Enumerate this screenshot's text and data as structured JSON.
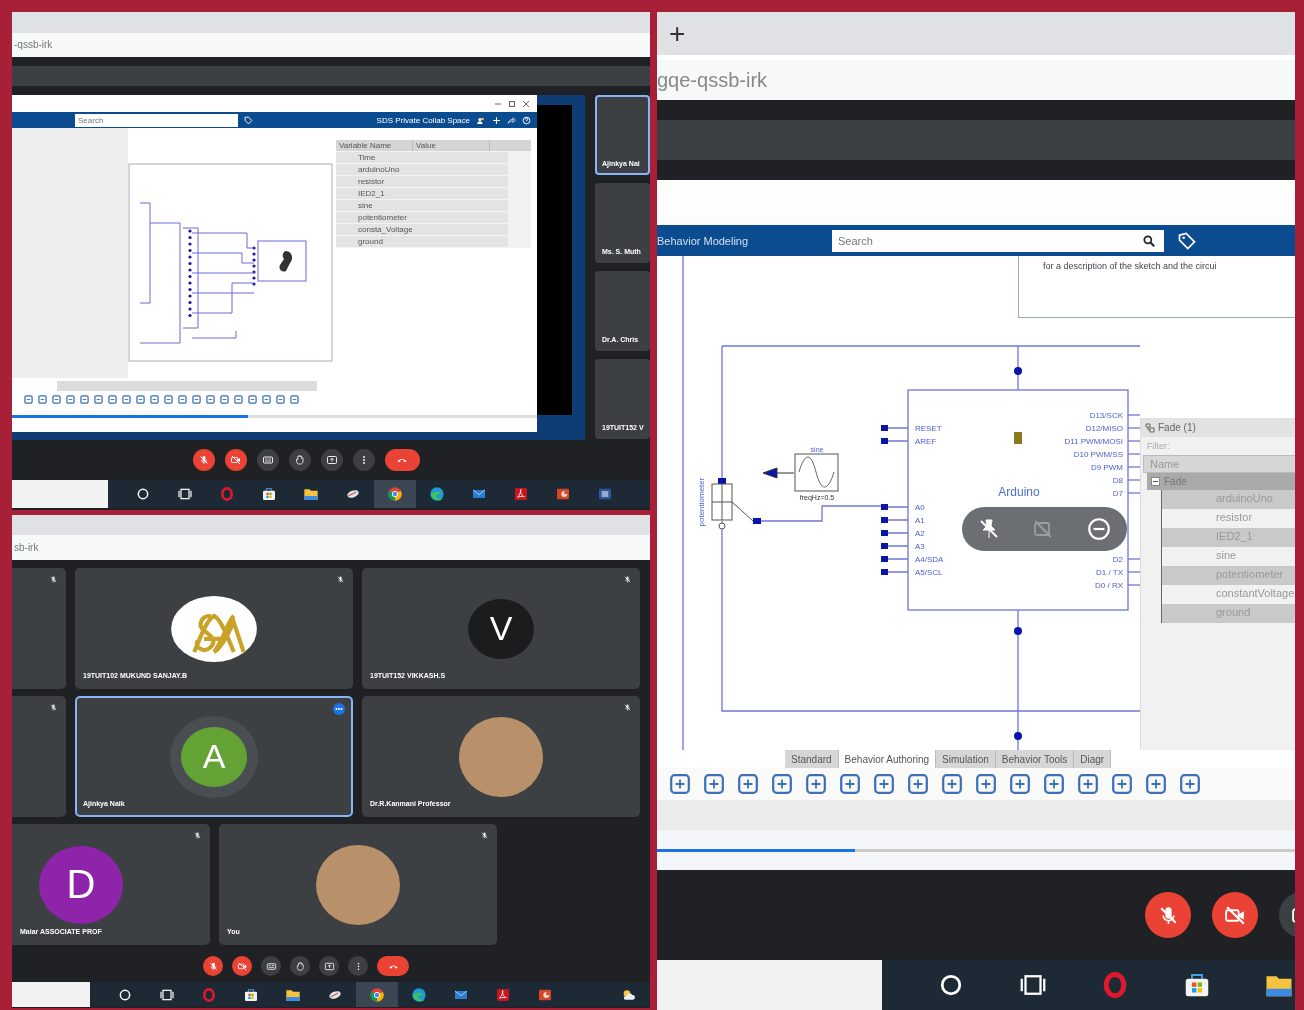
{
  "shared_screen": {
    "url": "-qssb-irk",
    "app": {
      "workspace": "SDS Private Collab Space",
      "search": {
        "placeholder": "Search"
      },
      "columns": [
        "Variable Name",
        "Value"
      ],
      "variables": [
        {
          "name": "Time"
        },
        {
          "name": "arduinoUno"
        },
        {
          "name": "resistor"
        },
        {
          "name": "IED2_1"
        },
        {
          "name": "sine"
        },
        {
          "name": "potentiometer"
        },
        {
          "name": "consta_Voltage"
        },
        {
          "name": "ground"
        }
      ]
    },
    "progress": {
      "level": 0.45
    },
    "participants": [
      {
        "name": "Ajinkya Nai",
        "selected": true
      },
      {
        "name": "Ms. S. Muth",
        "selected": false
      },
      {
        "name": "Dr.A. Chris",
        "selected": false
      },
      {
        "name": "19TUIT152 V",
        "selected": false
      }
    ],
    "controls": [
      {
        "kind": "mic-off"
      },
      {
        "kind": "camera-off"
      },
      {
        "kind": "captions"
      },
      {
        "kind": "hand"
      },
      {
        "kind": "present"
      },
      {
        "kind": "more"
      },
      {
        "kind": "end-call"
      }
    ],
    "taskbar": [
      {
        "kind": "search",
        "selected": false
      },
      {
        "kind": "task-view",
        "selected": false
      },
      {
        "kind": "opera",
        "selected": false
      },
      {
        "kind": "store",
        "selected": false
      },
      {
        "kind": "files",
        "selected": false
      },
      {
        "kind": "app",
        "selected": false
      },
      {
        "kind": "chrome",
        "selected": true
      },
      {
        "kind": "edge",
        "selected": false
      },
      {
        "kind": "mail",
        "selected": false
      },
      {
        "kind": "pdf",
        "selected": false
      },
      {
        "kind": "slides",
        "selected": false
      },
      {
        "kind": "word",
        "selected": false
      }
    ]
  },
  "grid_view": {
    "url": "sb-irk",
    "rows": [
      {
        "tiles": [
          {
            "kind": "partial",
            "muted": true,
            "selected": false
          },
          {
            "kind": "logo",
            "name": "19TUIT102 MUKUND SANJAY.B",
            "muted": true,
            "selected": false
          },
          {
            "kind": "letter",
            "initial": "V",
            "color": "#1b1c1e",
            "name": "19TUIT152 VIKKASH.S",
            "muted": true,
            "selected": false
          }
        ]
      },
      {
        "tiles": [
          {
            "kind": "partial",
            "muted": true,
            "selected": false
          },
          {
            "kind": "letter",
            "initial": "A",
            "color": "#63a234",
            "name": "Ajinkya Naik",
            "muted": false,
            "selected": true
          },
          {
            "kind": "photo",
            "name": "Dr.R.Kanmani Professor",
            "muted": true,
            "selected": false
          }
        ]
      },
      {
        "tiles": [
          {
            "kind": "letter",
            "initial": "D",
            "color": "#8e24aa",
            "name": "Maiar ASSOCIATE PROF",
            "muted": true,
            "selected": false
          },
          {
            "kind": "photo",
            "name": "You",
            "muted": true,
            "selected": false
          }
        ]
      }
    ],
    "controls": [
      {
        "kind": "mic-off"
      },
      {
        "kind": "camera-off"
      },
      {
        "kind": "captions"
      },
      {
        "kind": "hand"
      },
      {
        "kind": "present"
      },
      {
        "kind": "more"
      },
      {
        "kind": "end-call"
      }
    ],
    "taskbar": [
      {
        "kind": "search",
        "selected": false
      },
      {
        "kind": "task-view",
        "selected": false
      },
      {
        "kind": "opera",
        "selected": false
      },
      {
        "kind": "store",
        "selected": false
      },
      {
        "kind": "files",
        "selected": false
      },
      {
        "kind": "app",
        "selected": false
      },
      {
        "kind": "chrome",
        "selected": true
      },
      {
        "kind": "edge",
        "selected": false
      },
      {
        "kind": "mail",
        "selected": false
      },
      {
        "kind": "pdf",
        "selected": false
      },
      {
        "kind": "slides",
        "selected": false
      },
      {
        "kind": "weather",
        "selected": false
      }
    ]
  },
  "zoomed_view": {
    "new_tab": "+",
    "url": "gqe-qssb-irk",
    "app_title": "Behavior Modeling",
    "search": {
      "placeholder": "Search"
    },
    "note": "for a description of the sketch and the circui",
    "diagram": {
      "board": "Arduino",
      "left_pins": [
        "RESET",
        "AREF",
        "A0",
        "A1",
        "A2",
        "A3",
        "A4/SDA",
        "A5/SCL"
      ],
      "right_pins": [
        "D13/SCK",
        "D12/MISO",
        "D11 PWM/MOSI",
        "D10 PWM/SS",
        "D9 PWM",
        "D8",
        "D7",
        "D2",
        "D1 / TX",
        "D0 / RX"
      ],
      "source": "sine",
      "source_param": "freqHz=0.5",
      "component": "potentiometer"
    },
    "model_browser": {
      "tab": "Fade (1)",
      "filter": "Filter:",
      "column": "Name",
      "root": {
        "name": "Fade",
        "expanded": true,
        "children": [
          {
            "name": "arduinoUno"
          },
          {
            "name": "resistor"
          },
          {
            "name": "IED2_1"
          },
          {
            "name": "sine"
          },
          {
            "name": "potentiometer"
          },
          {
            "name": "constantVoltage"
          },
          {
            "name": "ground"
          }
        ]
      }
    },
    "tabs": [
      {
        "label": "Standard",
        "selected": false
      },
      {
        "label": "Behavior Authoring",
        "selected": true
      },
      {
        "label": "Simulation",
        "selected": false
      },
      {
        "label": "Behavior Tools",
        "selected": false
      },
      {
        "label": "Diagr",
        "selected": false
      }
    ],
    "progress": {
      "level": 0.31
    },
    "controls": [
      {
        "kind": "mic-off"
      },
      {
        "kind": "camera-off"
      },
      {
        "kind": "captions"
      }
    ],
    "taskbar": [
      {
        "kind": "search",
        "selected": false
      },
      {
        "kind": "task-view",
        "selected": false
      },
      {
        "kind": "opera",
        "selected": false
      },
      {
        "kind": "store",
        "selected": false
      },
      {
        "kind": "files",
        "selected": false
      }
    ]
  }
}
